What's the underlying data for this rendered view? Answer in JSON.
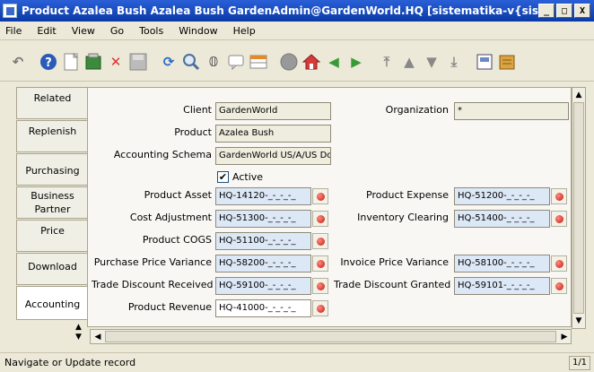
{
  "window": {
    "title": "Product  Azalea Bush  Azalea Bush  GardenAdmin@GardenWorld.HQ [sistematika-v{sistematika-v...",
    "minimize": "_",
    "maximize": "□",
    "close": "X"
  },
  "menu": [
    "File",
    "Edit",
    "View",
    "Go",
    "Tools",
    "Window",
    "Help"
  ],
  "toolbar_icons": [
    "undo-icon",
    "help-icon",
    "new-record-icon",
    "copy-record-icon",
    "delete-icon",
    "save-icon",
    "refresh-icon",
    "find-icon",
    "attachment-icon",
    "chat-icon",
    "grid-toggle-icon",
    "history-icon",
    "home-icon",
    "parent-icon",
    "detail-icon",
    "first-record-icon",
    "previous-record-icon",
    "next-record-icon",
    "last-record-icon",
    "report-icon",
    "print-icon"
  ],
  "tabs": [
    "Related",
    "Replenish",
    "Purchasing",
    "Business Partner",
    "Price",
    "Download",
    "Accounting"
  ],
  "form": {
    "client_label": "Client",
    "client_value": "GardenWorld",
    "organization_label": "Organization",
    "organization_value": "*",
    "product_label": "Product",
    "product_value": "Azalea Bush",
    "schema_label": "Accounting Schema",
    "schema_value": "GardenWorld US/A/US Do",
    "active_label": "Active",
    "active_checked": "✔",
    "product_asset_label": "Product Asset",
    "product_asset_value": "HQ-14120-_-_-_-_",
    "product_expense_label": "Product Expense",
    "product_expense_value": "HQ-51200-_-_-_-_",
    "cost_adjustment_label": "Cost Adjustment",
    "cost_adjustment_value": "HQ-51300-_-_-_-_",
    "inventory_clearing_label": "Inventory Clearing",
    "inventory_clearing_value": "HQ-51400-_-_-_-_",
    "product_cogs_label": "Product COGS",
    "product_cogs_value": "HQ-51100-_-_-_-_",
    "ppv_label": "Purchase Price Variance",
    "ppv_value": "HQ-58200-_-_-_-_",
    "ipv_label": "Invoice Price Variance",
    "ipv_value": "HQ-58100-_-_-_-_",
    "tdr_label": "Trade Discount Received",
    "tdr_value": "HQ-59100-_-_-_-_",
    "tdg_label": "Trade Discount Granted",
    "tdg_value": "HQ-59101-_-_-_-_",
    "product_revenue_label": "Product Revenue",
    "product_revenue_value": "HQ-41000-_-_-_-_"
  },
  "status": {
    "text": "Navigate or Update record",
    "page": "1/1"
  }
}
